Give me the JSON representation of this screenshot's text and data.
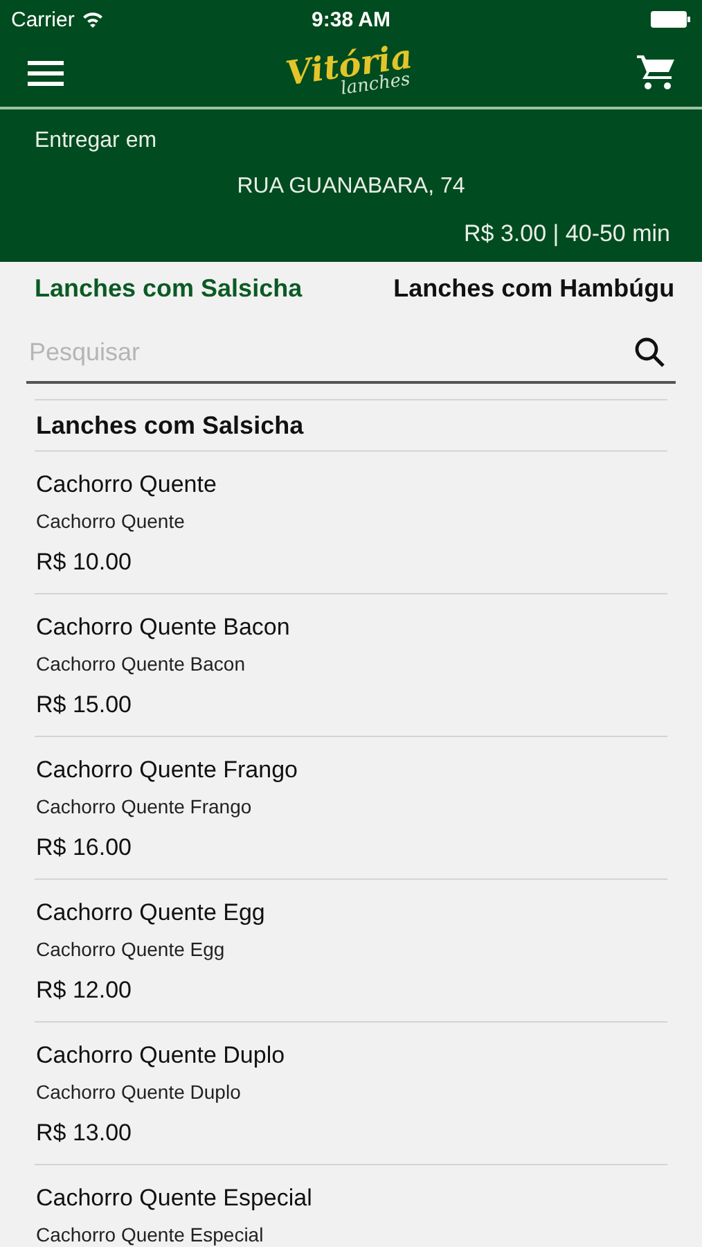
{
  "status_bar": {
    "carrier": "Carrier",
    "time": "9:38 AM"
  },
  "logo": {
    "title": "Vitória",
    "subtitle": "lanches"
  },
  "delivery": {
    "label": "Entregar em",
    "address": "RUA GUANABARA, 74",
    "info": "R$ 3.00 | 40-50 min"
  },
  "tabs": [
    {
      "label": "Lanches com Salsicha",
      "selected": true
    },
    {
      "label": "Lanches com Hambúgu",
      "selected": false
    }
  ],
  "search": {
    "placeholder": "Pesquisar"
  },
  "section": {
    "title": "Lanches com Salsicha"
  },
  "items": [
    {
      "name": "Cachorro Quente",
      "description": "Cachorro Quente",
      "price": "R$ 10.00"
    },
    {
      "name": "Cachorro Quente Bacon",
      "description": "Cachorro Quente Bacon",
      "price": "R$ 15.00"
    },
    {
      "name": "Cachorro Quente Frango",
      "description": "Cachorro Quente Frango",
      "price": "R$ 16.00"
    },
    {
      "name": "Cachorro Quente Egg",
      "description": "Cachorro Quente Egg",
      "price": "R$ 12.00"
    },
    {
      "name": "Cachorro Quente Duplo",
      "description": "Cachorro Quente Duplo",
      "price": "R$ 13.00"
    },
    {
      "name": "Cachorro Quente Especial",
      "description": "Cachorro Quente Especial"
    }
  ]
}
